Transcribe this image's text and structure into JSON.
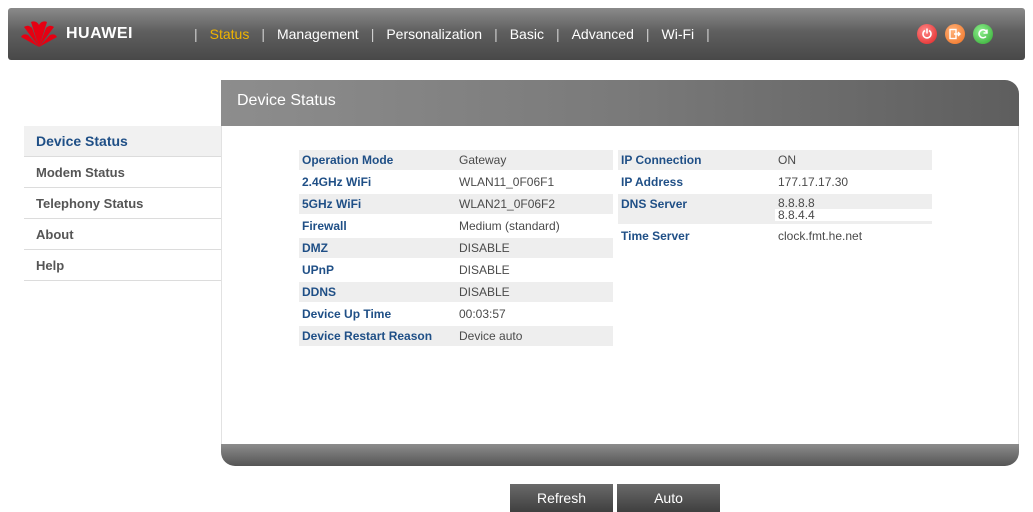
{
  "brand": {
    "name": "HUAWEI"
  },
  "nav": {
    "items": [
      "Status",
      "Management",
      "Personalization",
      "Basic",
      "Advanced",
      "Wi-Fi"
    ],
    "active": "Status",
    "separator": "|"
  },
  "top_icons": [
    "power-icon",
    "exit-icon",
    "refresh-icon"
  ],
  "sidebar": {
    "items": [
      "Device Status",
      "Modem Status",
      "Telephony Status",
      "About",
      "Help"
    ],
    "active": "Device Status"
  },
  "panel": {
    "title": "Device Status"
  },
  "status_left": [
    {
      "label": "Operation Mode",
      "value": "Gateway"
    },
    {
      "label": "2.4GHz WiFi",
      "value": "WLAN11_0F06F1"
    },
    {
      "label": "5GHz WiFi",
      "value": "WLAN21_0F06F2"
    },
    {
      "label": "Firewall",
      "value": "Medium (standard)"
    },
    {
      "label": "DMZ",
      "value": "DISABLE"
    },
    {
      "label": "UPnP",
      "value": "DISABLE"
    },
    {
      "label": "DDNS",
      "value": "DISABLE"
    },
    {
      "label": "Device Up Time",
      "value": "00:03:57"
    },
    {
      "label": "Device Restart Reason",
      "value": "Device auto"
    }
  ],
  "status_right": {
    "ip_connection": {
      "label": "IP Connection",
      "value": "ON"
    },
    "ip_address": {
      "label": "IP Address",
      "value": "177.17.17.30"
    },
    "dns_server": {
      "label": "DNS Server",
      "values": [
        "8.8.8.8",
        "8.8.4.4"
      ]
    },
    "time_server": {
      "label": "Time Server",
      "value": "clock.fmt.he.net"
    }
  },
  "buttons": {
    "refresh": "Refresh",
    "auto": "Auto"
  },
  "colors": {
    "active_nav": "#f0b400",
    "label_blue": "#1f4f86"
  }
}
